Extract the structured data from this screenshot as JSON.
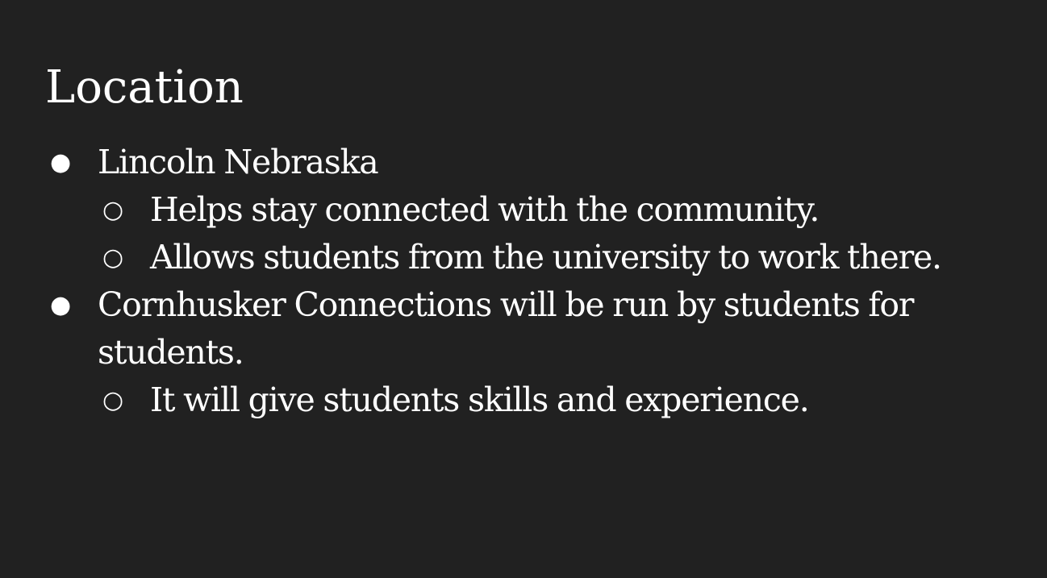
{
  "slide": {
    "title": "Location",
    "bullets": [
      {
        "level": 1,
        "bullet": "●",
        "text": "Lincoln Nebraska"
      },
      {
        "level": 2,
        "bullet": "○",
        "text": "Helps stay connected with the community."
      },
      {
        "level": 2,
        "bullet": "○",
        "text": "Allows students from the university to work there."
      },
      {
        "level": 1,
        "bullet": "●",
        "text": "Cornhusker Connections will be run by students for students."
      },
      {
        "level": 2,
        "bullet": "○",
        "text": "It will give students skills and experience."
      }
    ]
  }
}
